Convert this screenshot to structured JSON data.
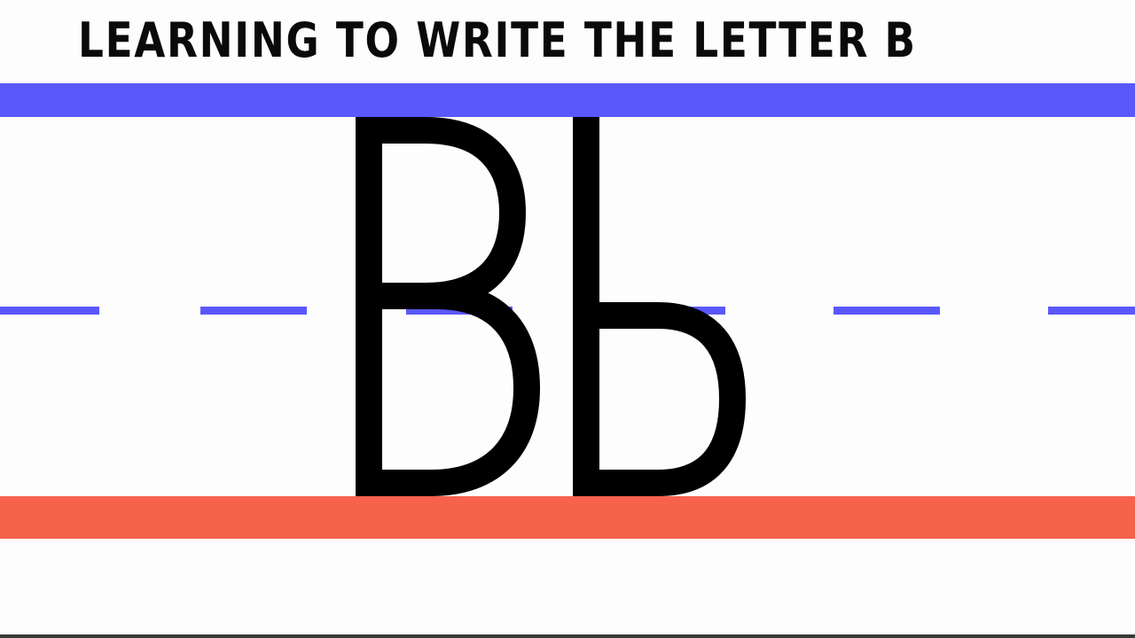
{
  "title": "LEARNING TO WRITE THE LETTER B",
  "uppercase_letter": "B",
  "lowercase_letter": "b",
  "colors": {
    "top_line": "#5a58fa",
    "midline_dashes": "#5a58fa",
    "baseline": "#f7624d",
    "letter_stroke": "#000000",
    "background": "#fdfdfd"
  }
}
